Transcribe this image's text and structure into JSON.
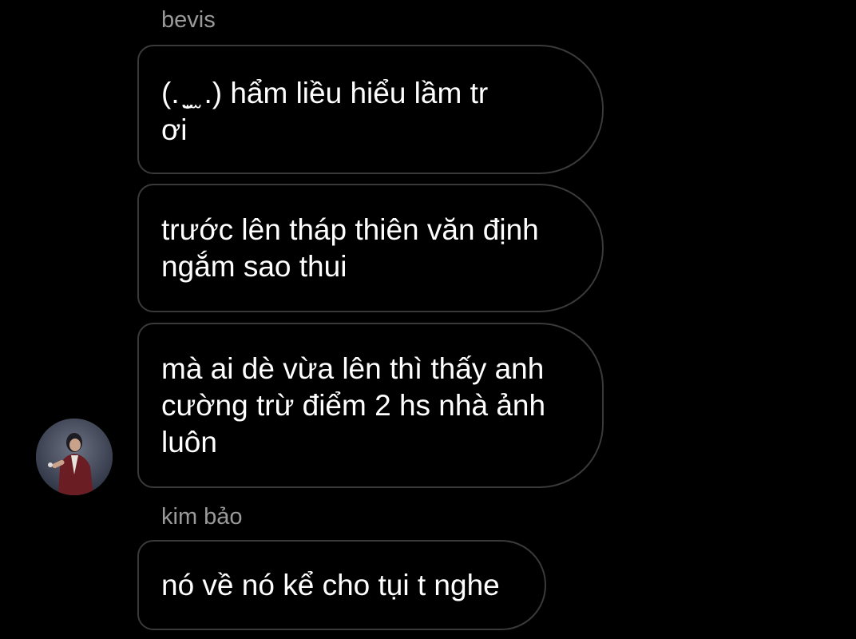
{
  "conversation": {
    "groups": [
      {
        "sender": "bevis",
        "messages": [
          "(. ̫̮ ̫ .) hẩm liều hiểu lầm tr\nơi",
          "trước lên tháp thiên văn định\nngắm sao thui",
          "mà ai dè vừa lên thì thấy anh\ncường trừ điểm 2 hs nhà ảnh\nluôn"
        ]
      },
      {
        "sender": "kim bảo",
        "messages": [
          "nó về nó kể cho tụi t nghe"
        ]
      }
    ],
    "avatar_icon": "user-photo-avatar"
  },
  "colors": {
    "background": "#000000",
    "bubble_border": "#3a3a3a",
    "sender_name": "#9a9a9a",
    "message_text": "#ffffff"
  }
}
